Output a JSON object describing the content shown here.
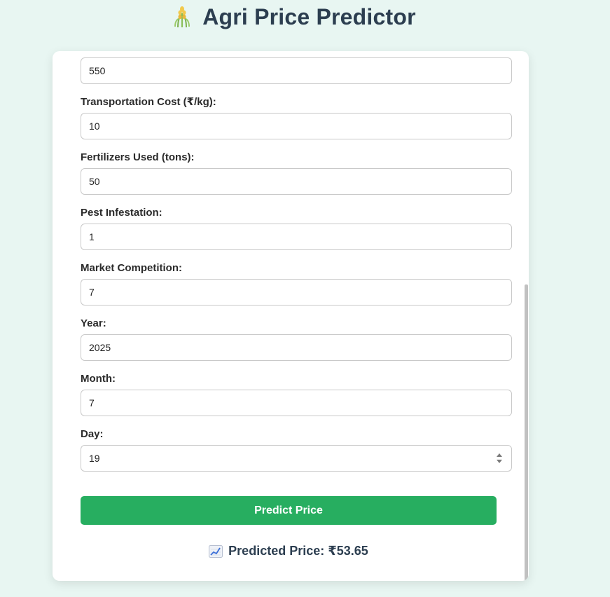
{
  "header": {
    "title": "Agri Price Predictor",
    "logo_icon": "wheat-sheaf-icon"
  },
  "form": {
    "partial_field_value": "550",
    "fields": [
      {
        "label": "Transportation Cost (₹/kg):",
        "value": "10"
      },
      {
        "label": "Fertilizers Used (tons):",
        "value": "50"
      },
      {
        "label": "Pest Infestation:",
        "value": "1"
      },
      {
        "label": "Market Competition:",
        "value": "7"
      },
      {
        "label": "Year:",
        "value": "2025"
      },
      {
        "label": "Month:",
        "value": "7"
      },
      {
        "label": "Day:",
        "value": "19"
      }
    ],
    "submit_label": "Predict Price"
  },
  "result": {
    "icon": "chart-increasing-icon",
    "text": "Predicted Price: ₹53.65"
  },
  "colors": {
    "accent": "#27ae60",
    "background": "#e8f6f2",
    "heading": "#2c3e50"
  }
}
